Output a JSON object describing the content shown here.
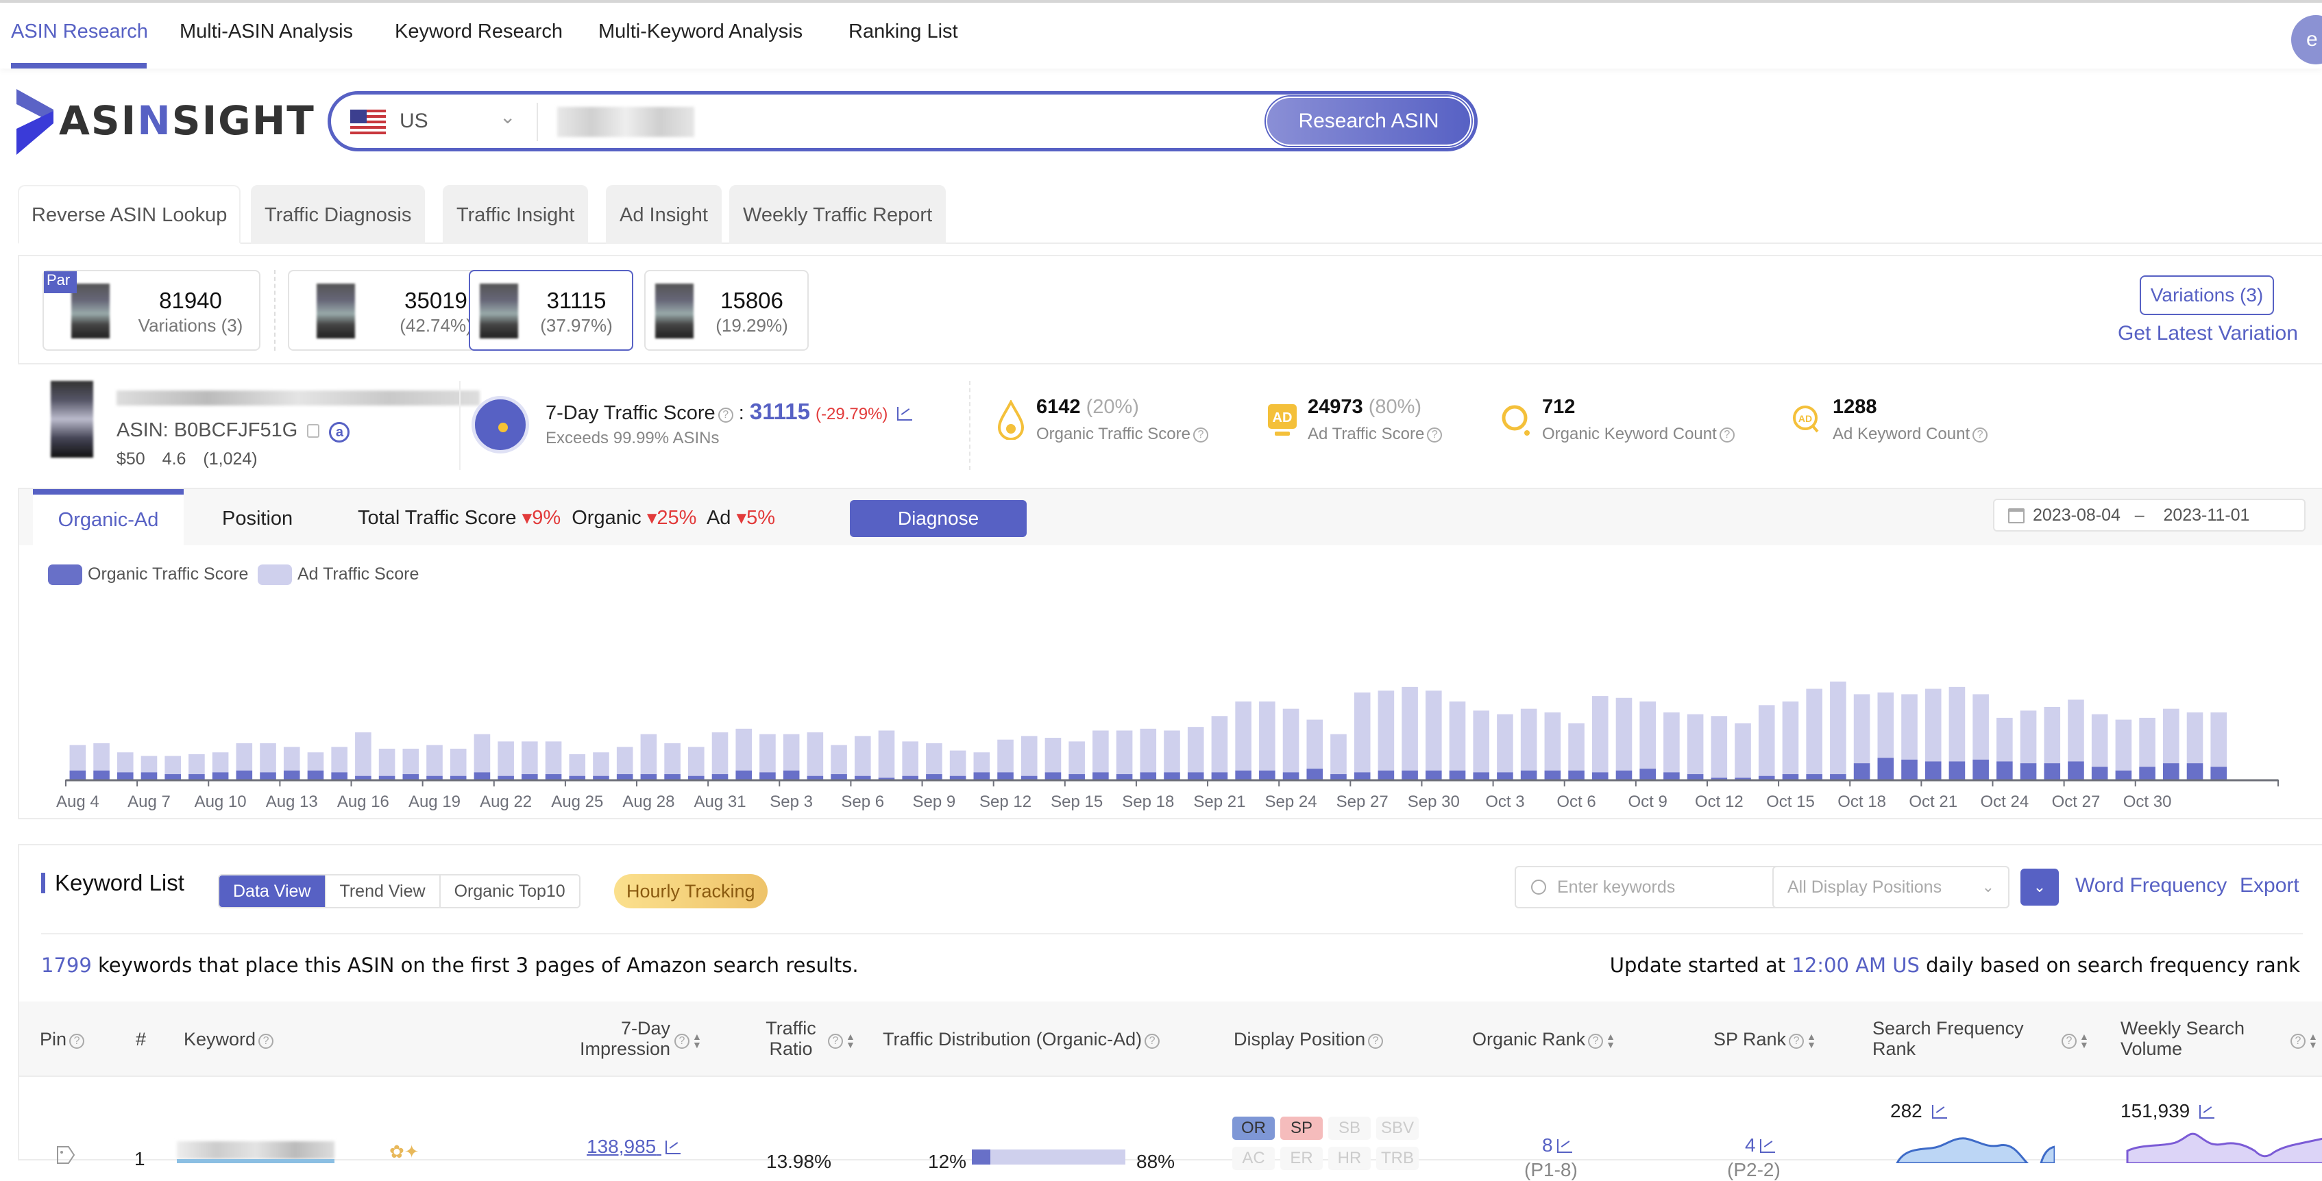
{
  "nav": {
    "items": [
      "ASIN Research",
      "Multi-ASIN Analysis",
      "Keyword Research",
      "Multi-Keyword Analysis",
      "Ranking List"
    ],
    "active": 0,
    "avatar_letter": "e"
  },
  "brand": {
    "logo_left": "ASI",
    "logo_mid": "N",
    "logo_right": "SIGHT"
  },
  "search": {
    "marketplace": "US",
    "button": "Research ASIN"
  },
  "subtabs": [
    "Reverse ASIN Lookup",
    "Traffic Diagnosis",
    "Traffic Insight",
    "Ad Insight",
    "Weekly Traffic Report"
  ],
  "variations": {
    "cards": [
      {
        "value": "81940",
        "sub": "Variations (3)",
        "badge": "Par"
      },
      {
        "value": "35019",
        "sub": "(42.74%)"
      },
      {
        "value": "31115",
        "sub": "(37.97%)",
        "selected": true
      },
      {
        "value": "15806",
        "sub": "(19.29%)"
      }
    ],
    "button": "Variations (3)",
    "latest_link": "Get Latest Variation"
  },
  "product": {
    "asin_label": "ASIN:",
    "asin": "B0BCFJF51G",
    "price": "$50",
    "rating": "4.6",
    "reviews": "(1,024)"
  },
  "traffic_score": {
    "label": "7-Day Traffic Score",
    "value": "31115",
    "change": "(-29.79%)",
    "sub": "Exceeds 99.99% ASINs"
  },
  "metrics": [
    {
      "value": "6142",
      "pct": "(20%)",
      "label": "Organic Traffic Score",
      "icon": "drop-icon"
    },
    {
      "value": "24973",
      "pct": "(80%)",
      "label": "Ad Traffic Score",
      "icon": "ad-icon"
    },
    {
      "value": "712",
      "pct": "",
      "label": "Organic Keyword Count",
      "icon": "search-organic-icon"
    },
    {
      "value": "1288",
      "pct": "",
      "label": "Ad Keyword Count",
      "icon": "search-ad-icon"
    }
  ],
  "chart_tabs": [
    "Organic-Ad",
    "Position"
  ],
  "changes": {
    "total_label": "Total Traffic Score",
    "total": "9%",
    "organic_label": "Organic",
    "organic": "25%",
    "ad_label": "Ad",
    "ad": "5%"
  },
  "diagnose": "Diagnose",
  "date_range": {
    "start": "2023-08-04",
    "sep": "–",
    "end": "2023-11-01"
  },
  "colors": {
    "accent": "#5761c4",
    "organic": "#6870c8",
    "ad": "#cfd0ed",
    "down": "#e23b3b"
  },
  "chart_data": {
    "type": "bar",
    "stacked": true,
    "title": "",
    "xlabel": "",
    "ylabel": "",
    "y_units": "relative (no y-axis labels shown; tallest bar = 100)",
    "ylim": [
      0,
      100
    ],
    "grid": false,
    "legend": "top-left",
    "legend_entries": [
      "Organic Traffic Score",
      "Ad Traffic Score"
    ],
    "tick_labels": [
      "Aug 4",
      "Aug 7",
      "Aug 10",
      "Aug 13",
      "Aug 16",
      "Aug 19",
      "Aug 22",
      "Aug 25",
      "Aug 28",
      "Aug 31",
      "Sep 3",
      "Sep 6",
      "Sep 9",
      "Sep 12",
      "Sep 15",
      "Sep 18",
      "Sep 21",
      "Sep 24",
      "Sep 27",
      "Sep 30",
      "Oct 3",
      "Oct 6",
      "Oct 9",
      "Oct 12",
      "Oct 15",
      "Oct 18",
      "Oct 21",
      "Oct 24",
      "Oct 27",
      "Oct 30"
    ],
    "start_date": "2023-08-04",
    "total": [
      19,
      20,
      15,
      13,
      13,
      14,
      15,
      20,
      20,
      18,
      15,
      18,
      26,
      17,
      17,
      19,
      17,
      25,
      21,
      21,
      21,
      14,
      15,
      18,
      25,
      20,
      18,
      26,
      28,
      25,
      25,
      26,
      19,
      24,
      27,
      21,
      20,
      16,
      15,
      22,
      24,
      23,
      21,
      27,
      27,
      28,
      27,
      29,
      35,
      43,
      43,
      39,
      33,
      25,
      48,
      49,
      51,
      49,
      43,
      38,
      36,
      39,
      37,
      31,
      46,
      45,
      43,
      37,
      36,
      35,
      31,
      41,
      43,
      50,
      54,
      47,
      48,
      47,
      50,
      51,
      47,
      34,
      38,
      40,
      44,
      36,
      33,
      34,
      39,
      37,
      37,
      36,
      34
    ],
    "organic": [
      5,
      5,
      4,
      4,
      3,
      3,
      4,
      5,
      4,
      5,
      5,
      4,
      2,
      2,
      3,
      2,
      2,
      4,
      2,
      3,
      3,
      2,
      2,
      3,
      3,
      3,
      2,
      3,
      5,
      4,
      5,
      2,
      3,
      2,
      1,
      2,
      3,
      2,
      4,
      4,
      2,
      4,
      3,
      4,
      3,
      4,
      4,
      4,
      4,
      5,
      5,
      4,
      6,
      3,
      4,
      5,
      5,
      5,
      5,
      4,
      4,
      5,
      5,
      5,
      4,
      5,
      6,
      4,
      3,
      1,
      1,
      2,
      3,
      3,
      3,
      9,
      12,
      11,
      10,
      10,
      11,
      10,
      9,
      9,
      10,
      7,
      5,
      7,
      9,
      9,
      7
    ]
  },
  "keyword_list": {
    "title": "Keyword List",
    "views": [
      "Data View",
      "Trend View",
      "Organic Top10"
    ],
    "active_view": 0,
    "hourly": "Hourly Tracking",
    "search_placeholder": "Enter keywords",
    "display_select": "All Display Positions",
    "word_frequency": "Word Frequency",
    "export": "Export",
    "count": "1799",
    "summary": " keywords that place this ASIN on the first 3 pages of Amazon search results.",
    "update_pre": "Update started at ",
    "update_time": "12:00 AM US",
    "update_post": " daily based on search frequency rank",
    "columns": [
      "Pin",
      "#",
      "Keyword",
      "7-Day Impression",
      "Traffic Ratio",
      "Traffic Distribution (Organic-Ad)",
      "Display Position",
      "Organic Rank",
      "SP Rank",
      "Search Frequency Rank",
      "Weekly Search Volume"
    ],
    "rows": [
      {
        "index": "1",
        "impression": "138,985",
        "traffic_ratio": "13.98%",
        "organic_pct": "12%",
        "ad_pct": "88%",
        "organic_share": 0.12,
        "positions_active": [
          "OR",
          "SP"
        ],
        "positions_inactive": [
          "SB",
          "SBV",
          "AC",
          "ER",
          "HR",
          "TRB"
        ],
        "organic_rank": "8",
        "organic_page": "(P1-8)",
        "sp_rank": "4",
        "sp_page": "(P2-2)",
        "sfr": "282",
        "weekly_volume": "151,939"
      }
    ]
  }
}
